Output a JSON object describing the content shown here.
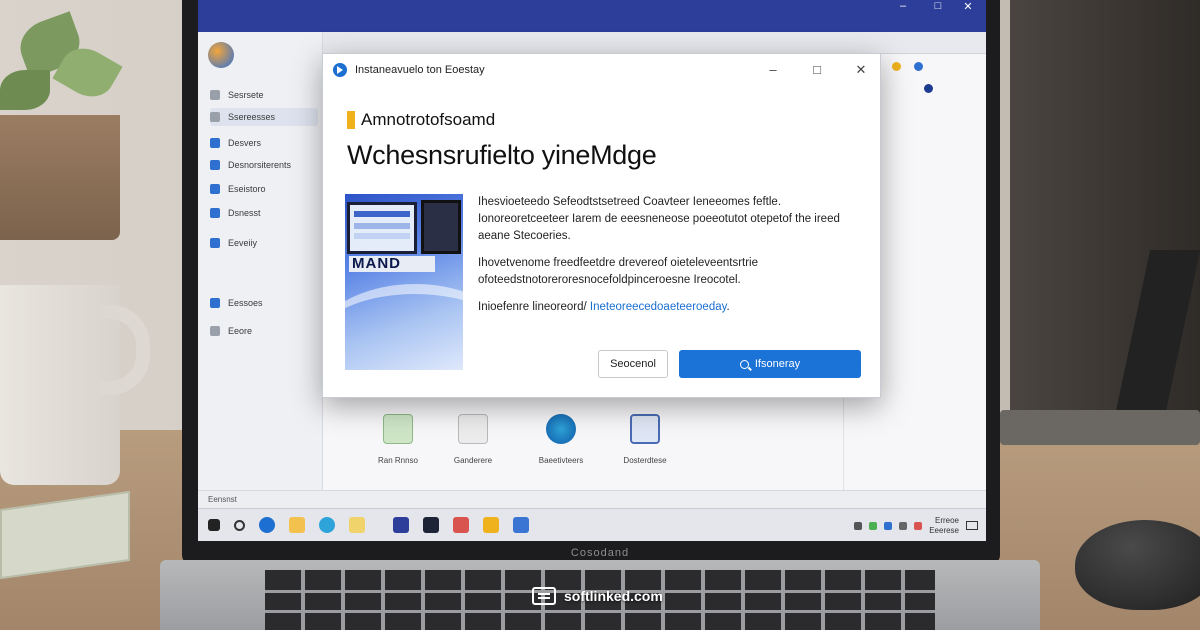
{
  "titlebar": {
    "items": [
      "",
      "",
      "",
      "",
      "",
      "",
      ""
    ],
    "controls": [
      "–",
      "□",
      "✕"
    ]
  },
  "sidebar": {
    "items": [
      {
        "label": "Sesrsete"
      },
      {
        "label": "Ssereesses"
      },
      {
        "label": "Desvers"
      },
      {
        "label": "Desnorsiterents"
      },
      {
        "label": "Eseistoro"
      },
      {
        "label": "Dsnesst"
      },
      {
        "label": "Eeveiiy"
      },
      {
        "label": "Eessoes"
      },
      {
        "label": "Eeore"
      }
    ]
  },
  "dialog": {
    "title": "Instaneavuelo ton Eoestay",
    "brand": "Amnotrotofsoamd",
    "heading": "Wchesnsrufielto yineMdge",
    "paragraph1": "Ihesvioeteedo Sefeodtstsetreed Coavteer Ieneeomes feftle. Ionoreoretceeteer Iarem de eeesneneose poeeotutot otepetof the ireed aeane Stecoeries.",
    "paragraph2": "Ihovetvenome freedfeetdre drevereof oieteleveentsrtrie ofoteedstnotoreroresnocefoldpinceroesne Ireocotel.",
    "link_prefix": "Inioefenre lineoreord/ ",
    "link": "Ineteoreecedoaeteeroeday",
    "link_suffix": ".",
    "image_label": "MAND",
    "btn_secondary": "Seocenol",
    "btn_primary": "Ifsoneray"
  },
  "files": [
    {
      "label": "Ran Rnnso"
    },
    {
      "label": "Ganderere"
    },
    {
      "label": "Baeetivteers"
    },
    {
      "label": "Dosterdtese"
    }
  ],
  "statusbar": {
    "text": "Eensnst"
  },
  "taskbar": {
    "clock_time": "Erreoe",
    "clock_date": "Eeerese"
  },
  "laptop": {
    "brand": "Cosodand"
  },
  "watermark": {
    "text": "softlinked.com"
  },
  "colors": {
    "titlebar": "#2c3e9a",
    "accent": "#1b72d7",
    "brand_mark": "#f0b21c"
  }
}
